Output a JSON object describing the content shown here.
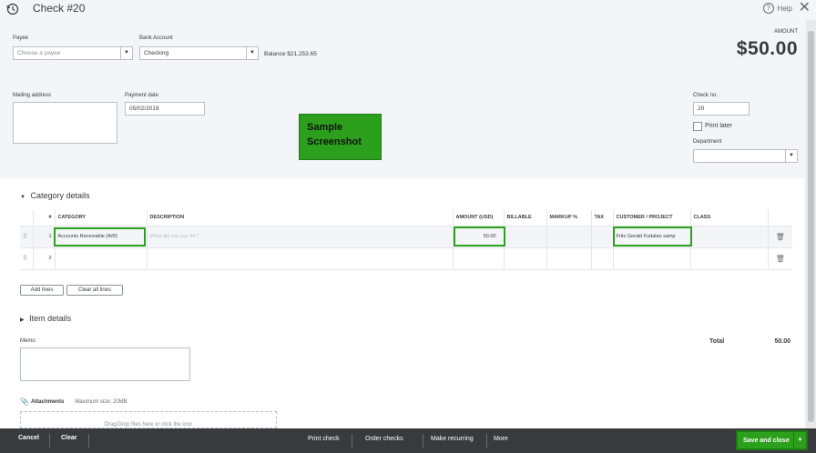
{
  "header": {
    "title": "Check #20",
    "help": "Help"
  },
  "form": {
    "payee_label": "Payee",
    "payee_placeholder": "Choose a payee",
    "bank_label": "Bank Account",
    "bank_value": "Checking",
    "balance": "Balance $21,253.65",
    "amount_label": "AMOUNT",
    "amount_value": "$50.00",
    "mailing_label": "Mailing address",
    "payment_date_label": "Payment date",
    "payment_date": "05/02/2019",
    "check_no_label": "Check no.",
    "check_no": "20",
    "print_later": "Print later",
    "department_label": "Department"
  },
  "sample_note": {
    "line1": "Sample",
    "line2": "Screenshot"
  },
  "category": {
    "heading": "Category details",
    "headers": [
      "#",
      "CATEGORY",
      "DESCRIPTION",
      "AMOUNT (USD)",
      "BILLABLE",
      "MARKUP %",
      "TAX",
      "CUSTOMER / PROJECT",
      "CLASS"
    ],
    "rows": [
      {
        "num": "1",
        "category": "Accounts Receivable (A/R)",
        "description_ph": "What did you pay for?",
        "amount": "50.00",
        "customer": "Fritz Gerald Fudalan samp"
      },
      {
        "num": "2",
        "category": "",
        "description_ph": "",
        "amount": "",
        "customer": ""
      }
    ],
    "add_lines": "Add lines",
    "clear_lines": "Clear all lines"
  },
  "item": {
    "heading": "Item details"
  },
  "memo_label": "Memo",
  "total": {
    "label": "Total",
    "value": "50.00"
  },
  "attachments": {
    "label": "Attachments",
    "max": "Maximum size: 20MB",
    "drop": "Drag/Drop files here or click the icon"
  },
  "footer": {
    "cancel": "Cancel",
    "clear": "Clear",
    "print_check": "Print check",
    "order_checks": "Order checks",
    "make_recurring": "Make recurring",
    "more": "More",
    "save_close": "Save and close"
  }
}
